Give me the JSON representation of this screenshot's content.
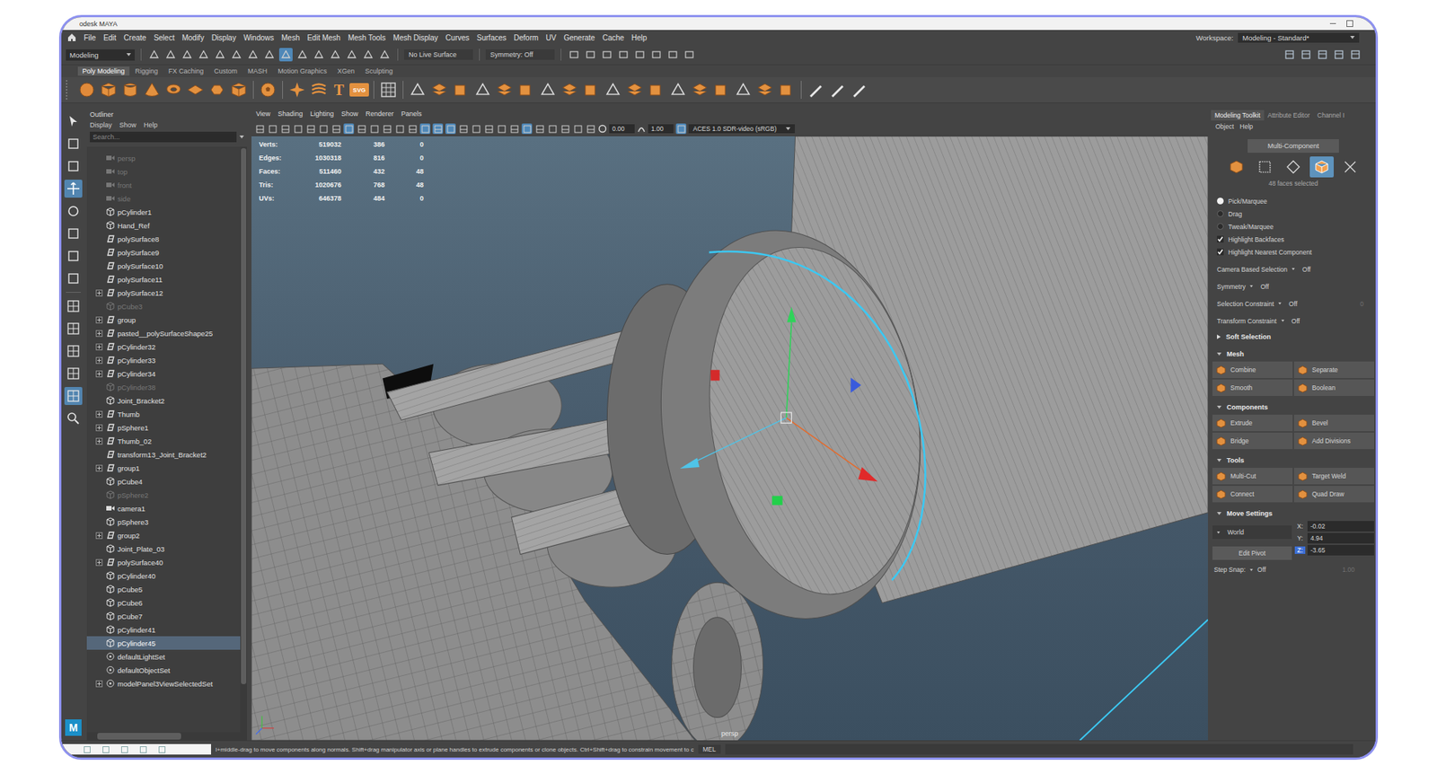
{
  "frame": {
    "title": "odesk MAYA",
    "logo": "M"
  },
  "menu_bar": {
    "items": [
      "File",
      "Edit",
      "Create",
      "Select",
      "Modify",
      "Display",
      "Windows",
      "Mesh",
      "Edit Mesh",
      "Mesh Tools",
      "Mesh Display",
      "Curves",
      "Surfaces",
      "Deform",
      "UV",
      "Generate",
      "Cache",
      "Help"
    ],
    "workspace_label": "Workspace:",
    "workspace_value": "Modeling - Standard*"
  },
  "status_line": {
    "mode": "Modeling",
    "live_surface": "No Live Surface",
    "symmetry": "Symmetry: Off",
    "tools": [
      {
        "on": false
      },
      {
        "on": false
      },
      {
        "on": false
      },
      {
        "on": false
      },
      {
        "on": false
      },
      {
        "on": false
      },
      {
        "on": false
      },
      {
        "on": false
      },
      {
        "on": true
      },
      {
        "on": false
      },
      {
        "on": false
      },
      {
        "on": false
      },
      {
        "on": false
      },
      {
        "on": false
      },
      {
        "on": false
      }
    ]
  },
  "shelf": {
    "tabs": [
      {
        "label": "Poly Modeling",
        "selected": true
      },
      {
        "label": "Rigging",
        "selected": false
      },
      {
        "label": "FX Caching",
        "selected": false
      },
      {
        "label": "Custom",
        "selected": false
      },
      {
        "label": "MASH",
        "selected": false
      },
      {
        "label": "Motion Graphics",
        "selected": false
      },
      {
        "label": "XGen",
        "selected": false
      },
      {
        "label": "Sculpting",
        "selected": false
      }
    ],
    "glyph_icons": [
      "T",
      "SVG"
    ]
  },
  "outliner": {
    "title": "Outliner",
    "menu": [
      "Display",
      "Show",
      "Help"
    ],
    "search_placeholder": "Search...",
    "items": [
      {
        "name": "persp",
        "kind": "camera",
        "expandable": false,
        "hidden": true,
        "selected": false
      },
      {
        "name": "top",
        "kind": "camera",
        "expandable": false,
        "hidden": true,
        "selected": false
      },
      {
        "name": "front",
        "kind": "camera",
        "expandable": false,
        "hidden": true,
        "selected": false
      },
      {
        "name": "side",
        "kind": "camera",
        "expandable": false,
        "hidden": true,
        "selected": false
      },
      {
        "name": "pCylinder1",
        "kind": "mesh",
        "expandable": false,
        "hidden": false,
        "selected": false
      },
      {
        "name": "Hand_Ref",
        "kind": "mesh",
        "expandable": false,
        "hidden": false,
        "selected": false
      },
      {
        "name": "polySurface8",
        "kind": "group",
        "expandable": false,
        "hidden": false,
        "selected": false
      },
      {
        "name": "polySurface9",
        "kind": "group",
        "expandable": false,
        "hidden": false,
        "selected": false
      },
      {
        "name": "polySurface10",
        "kind": "group",
        "expandable": false,
        "hidden": false,
        "selected": false
      },
      {
        "name": "polySurface11",
        "kind": "group",
        "expandable": false,
        "hidden": false,
        "selected": false
      },
      {
        "name": "polySurface12",
        "kind": "group",
        "expandable": true,
        "hidden": false,
        "selected": false
      },
      {
        "name": "pCube3",
        "kind": "mesh",
        "expandable": false,
        "hidden": true,
        "selected": false
      },
      {
        "name": "group",
        "kind": "group",
        "expandable": true,
        "hidden": false,
        "selected": false
      },
      {
        "name": "pasted__polySurfaceShape25",
        "kind": "group",
        "expandable": true,
        "hidden": false,
        "selected": false
      },
      {
        "name": "pCylinder32",
        "kind": "group",
        "expandable": true,
        "hidden": false,
        "selected": false
      },
      {
        "name": "pCylinder33",
        "kind": "group",
        "expandable": true,
        "hidden": false,
        "selected": false
      },
      {
        "name": "pCylinder34",
        "kind": "group",
        "expandable": true,
        "hidden": false,
        "selected": false
      },
      {
        "name": "pCylinder38",
        "kind": "mesh",
        "expandable": false,
        "hidden": true,
        "selected": false
      },
      {
        "name": "Joint_Bracket2",
        "kind": "mesh",
        "expandable": false,
        "hidden": false,
        "selected": false
      },
      {
        "name": "Thumb",
        "kind": "group",
        "expandable": true,
        "hidden": false,
        "selected": false
      },
      {
        "name": "pSphere1",
        "kind": "group",
        "expandable": true,
        "hidden": false,
        "selected": false
      },
      {
        "name": "Thumb_02",
        "kind": "group",
        "expandable": true,
        "hidden": false,
        "selected": false
      },
      {
        "name": "transform13_Joint_Bracket2",
        "kind": "group",
        "expandable": false,
        "hidden": false,
        "selected": false
      },
      {
        "name": "group1",
        "kind": "group",
        "expandable": true,
        "hidden": false,
        "selected": false
      },
      {
        "name": "pCube4",
        "kind": "mesh",
        "expandable": false,
        "hidden": false,
        "selected": false
      },
      {
        "name": "pSphere2",
        "kind": "mesh",
        "expandable": false,
        "hidden": true,
        "selected": false
      },
      {
        "name": "camera1",
        "kind": "camera",
        "expandable": false,
        "hidden": false,
        "selected": false
      },
      {
        "name": "pSphere3",
        "kind": "mesh",
        "expandable": false,
        "hidden": false,
        "selected": false
      },
      {
        "name": "group2",
        "kind": "group",
        "expandable": true,
        "hidden": false,
        "selected": false
      },
      {
        "name": "Joint_Plate_03",
        "kind": "mesh",
        "expandable": false,
        "hidden": false,
        "selected": false
      },
      {
        "name": "polySurface40",
        "kind": "group",
        "expandable": true,
        "hidden": false,
        "selected": false
      },
      {
        "name": "pCylinder40",
        "kind": "mesh",
        "expandable": false,
        "hidden": false,
        "selected": false
      },
      {
        "name": "pCube5",
        "kind": "mesh",
        "expandable": false,
        "hidden": false,
        "selected": false
      },
      {
        "name": "pCube6",
        "kind": "mesh",
        "expandable": false,
        "hidden": false,
        "selected": false
      },
      {
        "name": "pCube7",
        "kind": "mesh",
        "expandable": false,
        "hidden": false,
        "selected": false
      },
      {
        "name": "pCylinder41",
        "kind": "mesh",
        "expandable": false,
        "hidden": false,
        "selected": false
      },
      {
        "name": "pCylinder45",
        "kind": "mesh",
        "expandable": false,
        "hidden": false,
        "selected": true
      },
      {
        "name": "defaultLightSet",
        "kind": "set",
        "expandable": false,
        "hidden": false,
        "selected": false
      },
      {
        "name": "defaultObjectSet",
        "kind": "set",
        "expandable": false,
        "hidden": false,
        "selected": false
      },
      {
        "name": "modelPanel3ViewSelectedSet",
        "kind": "set",
        "expandable": true,
        "hidden": false,
        "selected": false
      }
    ]
  },
  "viewport": {
    "menu": [
      "View",
      "Shading",
      "Lighting",
      "Show",
      "Renderer",
      "Panels"
    ],
    "toggles": [
      {
        "on": false
      },
      {
        "on": false
      },
      {
        "on": false
      },
      {
        "on": false
      },
      {
        "on": false
      },
      {
        "on": false
      },
      {
        "on": false
      },
      {
        "on": true
      },
      {
        "on": false
      },
      {
        "on": false
      },
      {
        "on": false
      },
      {
        "on": false
      },
      {
        "on": false
      },
      {
        "on": true
      },
      {
        "on": true
      },
      {
        "on": true
      },
      {
        "on": false
      },
      {
        "on": false
      },
      {
        "on": false
      },
      {
        "on": false
      },
      {
        "on": false
      },
      {
        "on": true
      },
      {
        "on": false
      },
      {
        "on": false
      },
      {
        "on": false
      },
      {
        "on": false
      },
      {
        "on": false
      }
    ],
    "exposure": "0.00",
    "gamma": "1.00",
    "color_space": "ACES 1.0 SDR-video (sRGB)",
    "hud": [
      {
        "label": "Verts:",
        "values": [
          "519032",
          "386",
          "0"
        ]
      },
      {
        "label": "Edges:",
        "values": [
          "1030318",
          "816",
          "0"
        ]
      },
      {
        "label": "Faces:",
        "values": [
          "511460",
          "432",
          "48"
        ]
      },
      {
        "label": "Tris:",
        "values": [
          "1020676",
          "768",
          "48"
        ]
      },
      {
        "label": "UVs:",
        "values": [
          "646378",
          "484",
          "0"
        ]
      }
    ],
    "camera": "persp"
  },
  "toolkit": {
    "tabs": [
      {
        "label": "Modeling Toolkit",
        "selected": true
      },
      {
        "label": "Attribute Editor",
        "selected": false
      },
      {
        "label": "Channel I",
        "selected": false
      }
    ],
    "menu": [
      "Object",
      "Help"
    ],
    "mode_button": "Multi-Component",
    "selection_modes": [
      {
        "selected": false
      },
      {
        "selected": false
      },
      {
        "selected": false
      },
      {
        "selected": true
      },
      {
        "selected": false
      }
    ],
    "selection_info": "48 faces selected",
    "pick_modes": [
      {
        "label": "Pick/Marquee",
        "selected": true
      },
      {
        "label": "Drag",
        "selected": false
      },
      {
        "label": "Tweak/Marquee",
        "selected": false
      }
    ],
    "checks": [
      {
        "label": "Highlight Backfaces",
        "checked": true
      },
      {
        "label": "Highlight Nearest Component",
        "checked": true
      }
    ],
    "options": [
      {
        "label": "Camera Based Selection",
        "value": "Off"
      },
      {
        "label": "Symmetry",
        "value": "Off"
      },
      {
        "label": "Selection Constraint",
        "value": "Off",
        "extra": "0"
      },
      {
        "label": "Transform Constraint",
        "value": "Off"
      }
    ],
    "sections": [
      {
        "title": "Soft Selection",
        "expanded": false,
        "buttons": []
      },
      {
        "title": "Mesh",
        "expanded": true,
        "buttons": [
          "Combine",
          "Separate",
          "Smooth",
          "Boolean"
        ]
      },
      {
        "title": "Components",
        "expanded": true,
        "buttons": [
          "Extrude",
          "Bevel",
          "Bridge",
          "Add Divisions"
        ]
      },
      {
        "title": "Tools",
        "expanded": true,
        "buttons": [
          "Multi-Cut",
          "Target Weld",
          "Connect",
          "Quad Draw"
        ]
      }
    ],
    "move_settings": {
      "title": "Move Settings",
      "expanded": true,
      "space": "World",
      "pivot_button": "Edit Pivot",
      "coords": [
        {
          "axis": "X:",
          "value": "-0.02",
          "selected": false
        },
        {
          "axis": "Y:",
          "value": "4.94",
          "selected": false
        },
        {
          "axis": "Z:",
          "value": "-3.65",
          "selected": true
        }
      ]
    },
    "step_snap": {
      "label": "Step Snap:",
      "value": "Off",
      "amount": "1.00",
      "amount_disabled": true
    }
  },
  "help_line": {
    "text": "l+middle-drag to move components along normals. Shift+drag manipulator axis or plane handles to extrude components or clone objects. Ctrl+Shift+drag to constrain movement to c",
    "language": "MEL"
  }
}
